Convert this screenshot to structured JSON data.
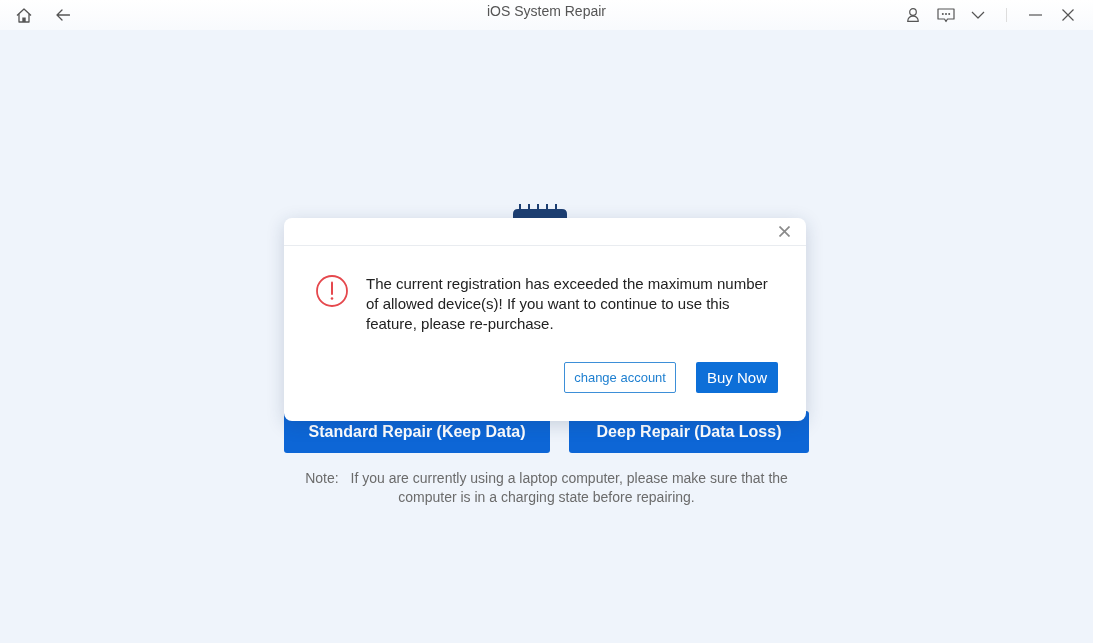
{
  "window": {
    "title": "iOS System Repair"
  },
  "main": {
    "buttons": [
      {
        "label": "Standard Repair (Keep Data)"
      },
      {
        "label": "Deep Repair (Data Loss)"
      }
    ],
    "note": {
      "label": "Note:",
      "text": "If you are currently using a laptop computer, please make sure that the computer is in a charging state before repairing."
    }
  },
  "dialog": {
    "message": "The current registration has exceeded the maximum number of allowed device(s)! If you want to continue to use this feature, please re-purchase.",
    "buttons": [
      {
        "label": "change account",
        "kind": "secondary"
      },
      {
        "label": "Buy Now",
        "kind": "primary"
      }
    ]
  }
}
